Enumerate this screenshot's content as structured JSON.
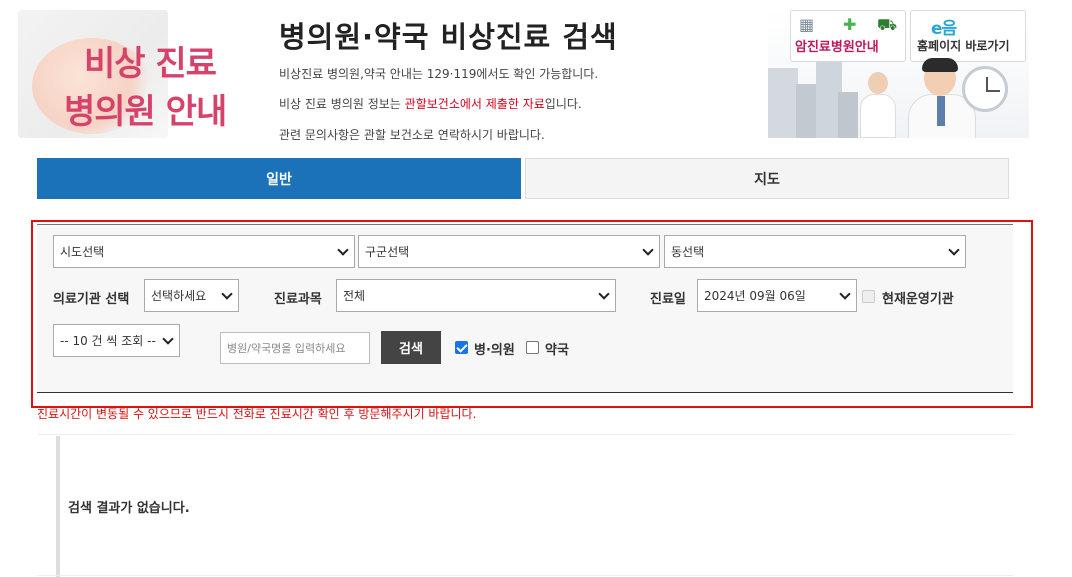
{
  "header": {
    "logo_line1": "비상 진료",
    "logo_line2": "병의원 안내",
    "title": "병의원·약국 비상진료 검색",
    "desc1": "비상진료 병의원,약국 안내는 129·119에서도 확인 가능합니다.",
    "desc2_prefix": "비상 진료 병의원 정보는 ",
    "desc2_highlight": "관할보건소에서 제출한 자료",
    "desc2_suffix": "입니다.",
    "desc3": "관련 문의사항은 관할 보건소로 연락하시기 바랍니다."
  },
  "banner": {
    "cancer_label": "암진료병원안내",
    "home_label": "홈페이지 바로가기",
    "home_logo_text": "e음"
  },
  "tabs": {
    "general": "일반",
    "map": "지도"
  },
  "search": {
    "sido": "시도선택",
    "gugun": "구군선택",
    "dong": "동선택",
    "institution_label": "의료기관 선택",
    "institution_value": "선택하세요",
    "department_label": "진료과목",
    "department_value": "전체",
    "date_label": "진료일",
    "date_value": "2024년 09월 06일",
    "operating_label": "현재운영기관",
    "page_size": "-- 10 건 씩 조회 --",
    "input_placeholder": "병원/약국명을 입력하세요",
    "search_button": "검색",
    "hospital_label": "병·의원",
    "pharmacy_label": "약국",
    "hospital_checked": true,
    "pharmacy_checked": false
  },
  "notice": "진료시간이 변동될 수 있으므로 반드시 전화로 진료시간 확인 후 방문해주시기 바랍니다.",
  "results": {
    "empty_message": "검색 결과가 없습니다."
  },
  "colors": {
    "primary_blue": "#1b72b9",
    "logo_pink": "#d6436a",
    "alert_red": "#e01010"
  }
}
